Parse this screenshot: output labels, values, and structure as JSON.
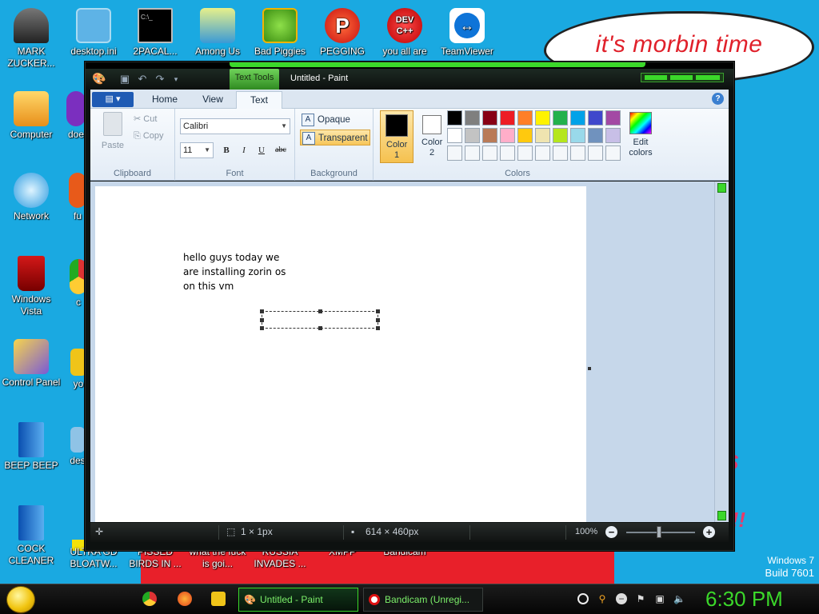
{
  "desktop": {
    "cloud_text": "it's morbin time",
    "side_art_text": "S\n\n!!!",
    "brand": {
      "line1": "Windows 7",
      "line2": "Build 7601"
    },
    "icons": [
      {
        "label": "MARK ZUCKER...",
        "icon": "person-icon"
      },
      {
        "label": "desktop.ini",
        "icon": "settings-file-icon"
      },
      {
        "label": "2PACAL...",
        "icon": "cmd-icon"
      },
      {
        "label": "Among Us",
        "icon": "among-us-icon"
      },
      {
        "label": "Bad Piggies",
        "icon": "bad-piggies-icon"
      },
      {
        "label": "PEGGING",
        "icon": "pegging-icon"
      },
      {
        "label": "you all are",
        "icon": "dev-cpp-icon"
      },
      {
        "label": "TeamViewer",
        "icon": "teamviewer-icon"
      },
      {
        "label": "Computer",
        "icon": "computer-icon"
      },
      {
        "label": "doe",
        "icon": "purple-app-icon"
      },
      {
        "label": "Network",
        "icon": "network-icon"
      },
      {
        "label": "fu",
        "icon": "app-icon"
      },
      {
        "label": "Windows Vista",
        "icon": "recycle-bin-icon"
      },
      {
        "label": "c",
        "icon": "chrome-icon"
      },
      {
        "label": "Control Panel",
        "icon": "control-panel-icon"
      },
      {
        "label": "yo",
        "icon": "folder-icon"
      },
      {
        "label": "BEEP BEEP",
        "icon": "blue-file-icon"
      },
      {
        "label": "des",
        "icon": "file-icon"
      },
      {
        "label": "COCK CLEANER",
        "icon": "blue-file-icon"
      },
      {
        "label": "ULTRA GD BLOATW...",
        "icon": "file-icon"
      },
      {
        "label": "PISSED BIRDS IN ...",
        "icon": "file-icon"
      },
      {
        "label": "what the fuck is goi...",
        "icon": "file-icon"
      },
      {
        "label": "RUSSIA INVADES ...",
        "icon": "file-icon"
      },
      {
        "label": "XMPP",
        "icon": "file-icon"
      },
      {
        "label": "Bandicam",
        "icon": "bandicam-icon"
      }
    ]
  },
  "paint": {
    "title": "Untitled - Paint",
    "context_tab": "Text Tools",
    "tabs": {
      "file": "▤ ▾",
      "home": "Home",
      "view": "View",
      "text": "Text"
    },
    "clipboard": {
      "paste": "Paste",
      "cut": "Cut",
      "copy": "Copy",
      "label": "Clipboard"
    },
    "font": {
      "family": "Calibri",
      "size": "11",
      "bold": "B",
      "italic": "I",
      "underline": "U",
      "strike": "abc",
      "label": "Font"
    },
    "background": {
      "opaque": "Opaque",
      "transparent": "Transparent",
      "label": "Background"
    },
    "colors": {
      "color1": "Color 1",
      "color2": "Color 2",
      "edit": "Edit colors",
      "label": "Colors",
      "color1_value": "#000000",
      "color2_value": "#ffffff",
      "palette": [
        "#000000",
        "#7f7f7f",
        "#880015",
        "#ed1c24",
        "#ff7f27",
        "#fff200",
        "#22b14c",
        "#00a2e8",
        "#3f48cc",
        "#a349a4",
        "#ffffff",
        "#c3c3c3",
        "#b97a57",
        "#ffaec9",
        "#ffc90e",
        "#efe4b0",
        "#b5e61d",
        "#99d9ea",
        "#7092be",
        "#c8bfe7",
        "",
        "",
        "",
        "",
        "",
        "",
        "",
        "",
        "",
        ""
      ]
    },
    "canvas_text": "hello guys today we\nare installing zorin os\non this vm",
    "status": {
      "cursor": "",
      "selection": "1 × 1px",
      "size": "614 × 460px",
      "zoom": "100%"
    }
  },
  "taskbar": {
    "tasks": [
      {
        "label": "Untitled - Paint"
      },
      {
        "label": "Bandicam (Unregi..."
      }
    ],
    "clock": "6:30 PM"
  }
}
